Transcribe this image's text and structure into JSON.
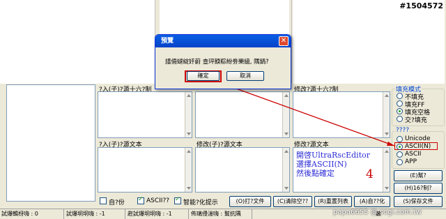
{
  "watermark_top": "#1504572",
  "watermark_bottom": "papa6655 @ sogi.com.tw",
  "panels": {
    "input_hex_label": "?入(子)?源十六?制",
    "modify_hex_label": "修改?源十六?制",
    "input_text_label": "?入(子)?源文本",
    "modify_input_text_label": "修改(子)?源文本",
    "modify_text_label": "修改?源文本"
  },
  "annotation": {
    "lines": [
      "開啓UltraRscEditor",
      "選擇ASCII(N)",
      "然後點確定"
    ],
    "number": "4"
  },
  "fill_mode": {
    "title": "填充模式",
    "options": [
      "不填充",
      "填充FF",
      "填充空格",
      "交?填充"
    ],
    "selected": 2
  },
  "encoding": {
    "title": "????",
    "options": [
      "Unicode",
      "ASCII(N)",
      "ASCII",
      "APP"
    ],
    "selected": 1
  },
  "side_buttons": {
    "help": "(E)幫?",
    "hex_convert": "(H)16?制?"
  },
  "bottom": {
    "auto_label": "自?份",
    "ascii_label": "ASCII??",
    "smart_label": "智能?化提示",
    "open_file": "(O)打?文件",
    "clear_empty": "(C)清除空??",
    "reset_list": "(R)重置列表",
    "auto_adjust": "(A)自??化",
    "save_file": "(S)保存文件",
    "auto_checked": false,
    "ascii_checked": true,
    "smart_checked": true
  },
  "status": {
    "c1": "試爆輯枒嗨 : 0",
    "c2": "試爆坰坰嗨 : -1",
    "c3": "趂試爆坰坰嗨 : -1",
    "c4": "佈璃侵湍嗨 : 幫抗隅",
    "c5": "鞁"
  },
  "dialog": {
    "title": "預覽",
    "message": "譆僥螁綻奸蔚    查玶餪粽紛劵樂繶, 隅鍋?",
    "ok": "確定",
    "cancel": "取消"
  },
  "colors": {
    "highlight_red": "#cc0000",
    "annot_blue": "#2b2bd6"
  }
}
